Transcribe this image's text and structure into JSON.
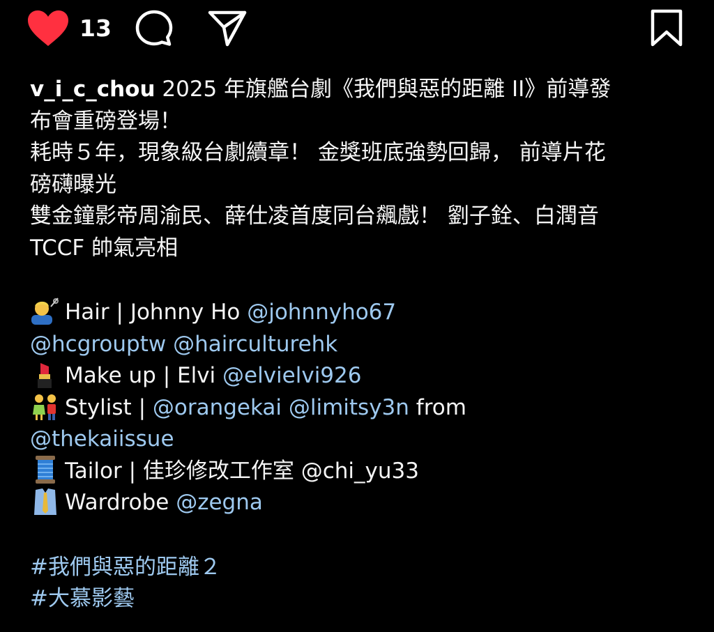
{
  "actions": {
    "like_count": "13",
    "icons": [
      "heart-icon",
      "comment-icon",
      "share-icon",
      "bookmark-icon"
    ],
    "heart_color": "#ff3040"
  },
  "caption": {
    "username": "v_i_c_chou",
    "intro_rest": " 2025 年旗艦台劇《我們與惡的距離 II》前導發",
    "intro_line2": "布會重磅登場！",
    "line3": "耗時５年，現象級台劇續章！ 金獎班底強勢回歸， 前導片花",
    "line4": "磅礴曝光",
    "line5": "雙金鐘影帝周渝民、薛仕凌首度同台飆戲！ 劉子銓、白潤音",
    "line6": "TCCF 帥氣亮相",
    "hair": {
      "text": "Hair | Johnny Ho ",
      "m1": "@johnnyho67",
      "m2": "@hcgrouptw",
      "m3": "@haircultureh k"
    },
    "makeup": {
      "text": "Make up | Elvi ",
      "m1": "@elvielvi926"
    },
    "stylist": {
      "text": "Stylist | ",
      "m1": "@orangekai",
      "m2": "@limitsy3n",
      "from": " from",
      "m3": "@thekaiissue"
    },
    "tailor": {
      "text": "Tailor | 佳珍修改工作室 @chi_yu33"
    },
    "wardrobe": {
      "text": "Wardrobe ",
      "m1": "@zegna"
    },
    "tag1": "#我們與惡的距離２",
    "tag2": "#大慕影藝"
  },
  "accent_color": "#9ec9ef"
}
